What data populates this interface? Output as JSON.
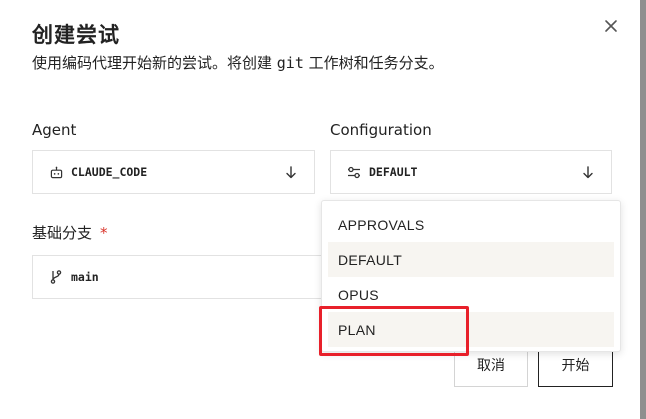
{
  "dialog": {
    "title": "创建尝试",
    "description_before": "使用编码代理开始新的尝试。将创建 ",
    "description_code": "git",
    "description_after": " 工作树和任务分支。"
  },
  "agent": {
    "label": "Agent",
    "value": "CLAUDE_CODE",
    "icon": "bot-icon"
  },
  "configuration": {
    "label": "Configuration",
    "value": "DEFAULT",
    "icon": "sliders-icon",
    "options": [
      "APPROVALS",
      "DEFAULT",
      "OPUS",
      "PLAN"
    ],
    "highlighted_options": [
      "DEFAULT",
      "PLAN"
    ]
  },
  "base_branch": {
    "label": "基础分支",
    "required_mark": "*",
    "value": "main",
    "icon": "git-branch-icon"
  },
  "buttons": {
    "cancel": "取消",
    "start": "开始"
  },
  "annotation": {
    "highlight_color": "#e8202a",
    "highlighted_option": "PLAN"
  }
}
